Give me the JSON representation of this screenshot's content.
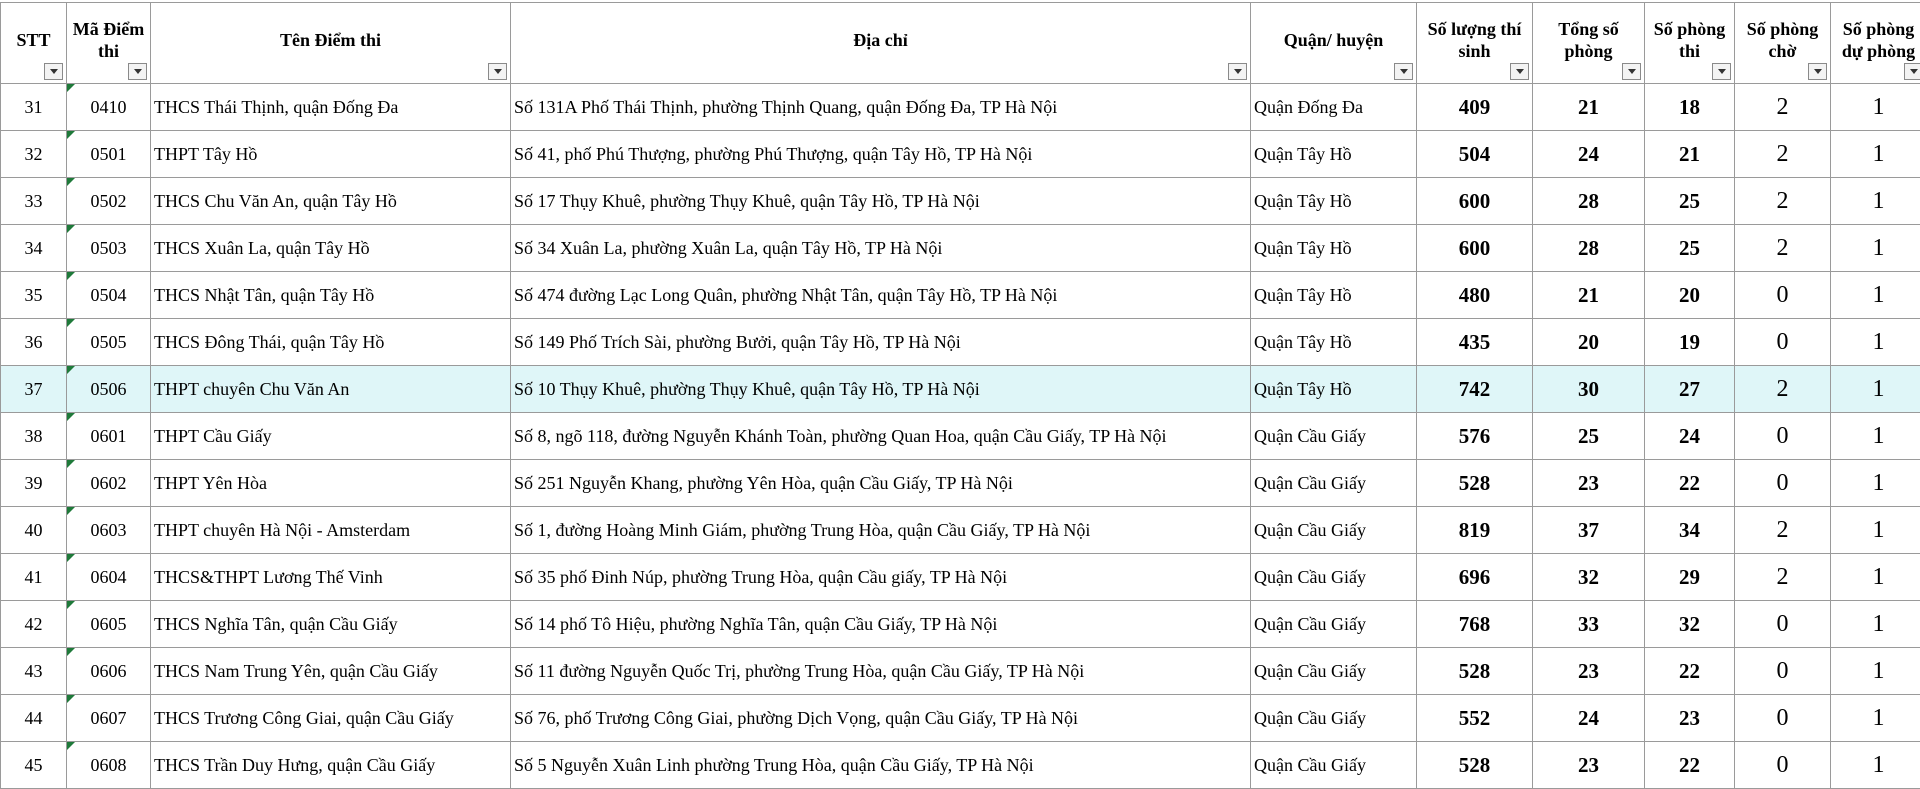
{
  "columns": [
    {
      "label": "STT"
    },
    {
      "label": "Mã Điểm thi"
    },
    {
      "label": "Tên Điểm thi"
    },
    {
      "label": "Địa chỉ"
    },
    {
      "label": "Quận/ huyện"
    },
    {
      "label": "Số lượng thí sinh"
    },
    {
      "label": "Tổng số phòng"
    },
    {
      "label": "Số phòng thi"
    },
    {
      "label": "Số phòng chờ"
    },
    {
      "label": "Số phòng dự phòng"
    }
  ],
  "rows": [
    {
      "stt": "31",
      "code": "0410",
      "name": "THCS Thái Thịnh, quận Đống Đa",
      "address": "Số 131A Phố Thái Thịnh, phường Thịnh Quang, quận Đống Đa, TP Hà Nội",
      "district": "Quận Đống Đa",
      "candidates": "409",
      "total_rooms": "21",
      "exam_rooms": "18",
      "waiting_rooms": "2",
      "reserve_rooms": "1"
    },
    {
      "stt": "32",
      "code": "0501",
      "name": "THPT Tây Hồ",
      "address": "Số 41, phố Phú Thượng, phường Phú Thượng, quận Tây Hồ, TP Hà Nội",
      "district": "Quận Tây Hồ",
      "candidates": "504",
      "total_rooms": "24",
      "exam_rooms": "21",
      "waiting_rooms": "2",
      "reserve_rooms": "1"
    },
    {
      "stt": "33",
      "code": "0502",
      "name": "THCS Chu Văn An, quận Tây Hồ",
      "address": "Số 17 Thụy Khuê, phường Thụy Khuê, quận Tây Hồ, TP Hà Nội",
      "district": "Quận Tây Hồ",
      "candidates": "600",
      "total_rooms": "28",
      "exam_rooms": "25",
      "waiting_rooms": "2",
      "reserve_rooms": "1"
    },
    {
      "stt": "34",
      "code": "0503",
      "name": "THCS Xuân La, quận Tây Hồ",
      "address": "Số 34 Xuân La, phường Xuân La, quận Tây Hồ, TP Hà Nội",
      "district": "Quận Tây Hồ",
      "candidates": "600",
      "total_rooms": "28",
      "exam_rooms": "25",
      "waiting_rooms": "2",
      "reserve_rooms": "1"
    },
    {
      "stt": "35",
      "code": "0504",
      "name": "THCS Nhật Tân, quận Tây Hồ",
      "address": "Số 474 đường Lạc Long Quân, phường Nhật Tân, quận Tây Hồ, TP Hà Nội",
      "district": "Quận Tây Hồ",
      "candidates": "480",
      "total_rooms": "21",
      "exam_rooms": "20",
      "waiting_rooms": "0",
      "reserve_rooms": "1"
    },
    {
      "stt": "36",
      "code": "0505",
      "name": "THCS Đông Thái, quận Tây Hồ",
      "address": "Số 149 Phố Trích Sài, phường Bưởi, quận Tây Hồ, TP Hà Nội",
      "district": "Quận Tây Hồ",
      "candidates": "435",
      "total_rooms": "20",
      "exam_rooms": "19",
      "waiting_rooms": "0",
      "reserve_rooms": "1"
    },
    {
      "stt": "37",
      "code": "0506",
      "name": "THPT chuyên Chu Văn An",
      "address": "Số 10 Thụy Khuê, phường Thụy Khuê, quận Tây Hồ, TP Hà Nội",
      "district": "Quận Tây Hồ",
      "candidates": "742",
      "total_rooms": "30",
      "exam_rooms": "27",
      "waiting_rooms": "2",
      "reserve_rooms": "1"
    },
    {
      "stt": "38",
      "code": "0601",
      "name": "THPT Cầu Giấy",
      "address": "Số 8, ngõ 118, đường Nguyễn Khánh Toàn, phường Quan Hoa, quận Cầu Giấy, TP Hà Nội",
      "district": "Quận Cầu Giấy",
      "candidates": "576",
      "total_rooms": "25",
      "exam_rooms": "24",
      "waiting_rooms": "0",
      "reserve_rooms": "1"
    },
    {
      "stt": "39",
      "code": "0602",
      "name": "THPT Yên Hòa",
      "address": "Số 251 Nguyễn Khang, phường Yên Hòa, quận Cầu Giấy, TP Hà Nội",
      "district": "Quận Cầu Giấy",
      "candidates": "528",
      "total_rooms": "23",
      "exam_rooms": "22",
      "waiting_rooms": "0",
      "reserve_rooms": "1"
    },
    {
      "stt": "40",
      "code": "0603",
      "name": "THPT chuyên Hà Nội - Amsterdam",
      "address": "Số 1, đường Hoàng Minh Giám, phường Trung Hòa, quận Cầu Giấy, TP Hà Nội",
      "district": "Quận Cầu Giấy",
      "candidates": "819",
      "total_rooms": "37",
      "exam_rooms": "34",
      "waiting_rooms": "2",
      "reserve_rooms": "1"
    },
    {
      "stt": "41",
      "code": "0604",
      "name": "THCS&THPT Lương Thế Vinh",
      "address": "Số 35 phố Đinh Núp, phường Trung Hòa, quận Cầu giấy, TP Hà Nội",
      "district": "Quận Cầu Giấy",
      "candidates": "696",
      "total_rooms": "32",
      "exam_rooms": "29",
      "waiting_rooms": "2",
      "reserve_rooms": "1"
    },
    {
      "stt": "42",
      "code": "0605",
      "name": "THCS Nghĩa Tân, quận Cầu Giấy",
      "address": "Số 14 phố Tô Hiệu, phường Nghĩa Tân, quận Cầu Giấy, TP Hà Nội",
      "district": "Quận Cầu Giấy",
      "candidates": "768",
      "total_rooms": "33",
      "exam_rooms": "32",
      "waiting_rooms": "0",
      "reserve_rooms": "1"
    },
    {
      "stt": "43",
      "code": "0606",
      "name": "THCS Nam Trung Yên, quận Cầu Giấy",
      "address": "Số 11 đường Nguyễn Quốc Trị, phường Trung Hòa, quận Cầu Giấy, TP Hà Nội",
      "district": "Quận Cầu Giấy",
      "candidates": "528",
      "total_rooms": "23",
      "exam_rooms": "22",
      "waiting_rooms": "0",
      "reserve_rooms": "1"
    },
    {
      "stt": "44",
      "code": "0607",
      "name": "THCS Trương Công Giai, quận Cầu Giấy",
      "address": "Số 76, phố Trương Công Giai, phường Dịch Vọng, quận Cầu Giấy, TP Hà Nội",
      "district": "Quận Cầu Giấy",
      "candidates": "552",
      "total_rooms": "24",
      "exam_rooms": "23",
      "waiting_rooms": "0",
      "reserve_rooms": "1"
    },
    {
      "stt": "45",
      "code": "0608",
      "name": "THCS Trần Duy Hưng, quận Cầu Giấy",
      "address": "Số 5 Nguyễn Xuân Linh phường Trung Hòa, quận Cầu Giấy, TP Hà Nội",
      "district": "Quận Cầu Giấy",
      "candidates": "528",
      "total_rooms": "23",
      "exam_rooms": "22",
      "waiting_rooms": "0",
      "reserve_rooms": "1"
    }
  ],
  "selected_row_stt": "37",
  "colors": {
    "selected_row_bg": "#dff6f8",
    "grid_line": "#9a9a9a",
    "cell_marker": "#1f7a3a"
  }
}
